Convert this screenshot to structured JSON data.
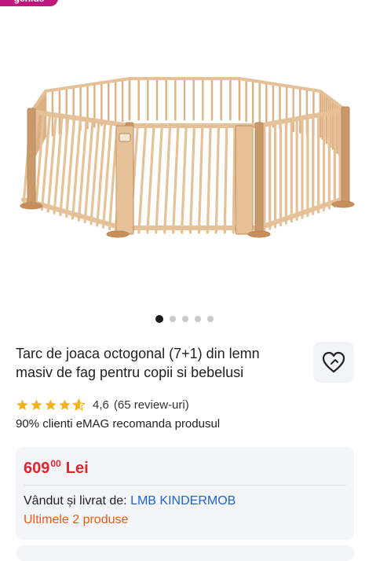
{
  "badge": {
    "label": "genius"
  },
  "gallery": {
    "image": "octagonal-wooden-playpen-image",
    "dot_count": 5,
    "active_index": 0
  },
  "product": {
    "title": "Tarc de joaca octogonal (7+1) din lemn masiv de fag pentru copii si bebelusi",
    "favorite_icon": "heart-icon"
  },
  "rating": {
    "stars": 4.6,
    "value": "4,6",
    "reviews": "(65 review-uri)",
    "star_color": "#f6b21a"
  },
  "recommend_text": "90% clienti eMAG recomanda produsul",
  "price": {
    "integer": "609",
    "decimals": "00",
    "currency": "Lei",
    "color": "#e0262c"
  },
  "seller": {
    "label": "Vândut și livrat de: ",
    "name": "LMB KINDERMOB",
    "link_color": "#1d63d8"
  },
  "stock": {
    "text": "Ultimele 2 produse",
    "color": "#ec5a11"
  }
}
